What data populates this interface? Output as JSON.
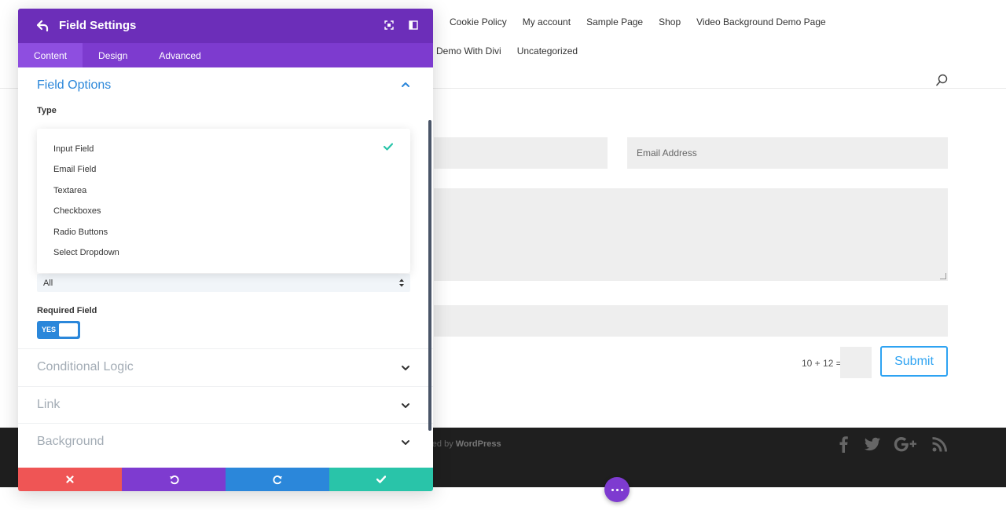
{
  "nav": {
    "row1": [
      "Cookie Policy",
      "My account",
      "Sample Page",
      "Shop",
      "Video Background Demo Page"
    ],
    "row2": [
      "d Demo With Divi",
      "Uncategorized"
    ]
  },
  "form": {
    "email_placeholder": "Email Address",
    "captcha": "10 + 12 =",
    "submit_label": "Submit"
  },
  "footer": {
    "credit_prefix": "ered by ",
    "credit_brand": "WordPress"
  },
  "modal": {
    "title": "Field Settings",
    "tabs": [
      "Content",
      "Design",
      "Advanced"
    ],
    "active_tab": "Content",
    "section_title": "Field Options",
    "type_label": "Type",
    "type_options": [
      "Input Field",
      "Email Field",
      "Textarea",
      "Checkboxes",
      "Radio Buttons",
      "Select Dropdown"
    ],
    "selected_type": "Input Field",
    "allowed_value": "All",
    "required_label": "Required Field",
    "required_toggle": "YES",
    "accordions": [
      "Conditional Logic",
      "Link",
      "Background"
    ]
  },
  "colors": {
    "header": "#6c2eb9",
    "tabs": "#7d3bcf",
    "accent_blue": "#2b87da",
    "cancel": "#ef5555",
    "undo": "#7e3bd0",
    "redo": "#2b87da",
    "save": "#29c4a9",
    "submit": "#2ea3f2"
  }
}
